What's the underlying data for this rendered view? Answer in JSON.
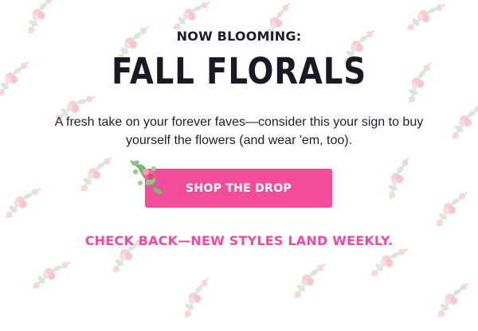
{
  "hero": {
    "eyebrow": "NOW BLOOMING:",
    "title": "FALL FLORALS",
    "body": "A fresh take on your forever faves—consider this your sign to buy yourself the flowers (and wear 'em, too).",
    "cta_label": "SHOP THE DROP",
    "note": "CHECK BACK—NEW STYLES LAND WEEKLY."
  },
  "colors": {
    "accent": "#f24d9a",
    "note_text": "#ef4aa3",
    "title_text": "#1a1a24",
    "pattern_rose": "#f3c8cf",
    "pattern_leaf": "#cfe5cf"
  },
  "icons": {
    "pattern": "rose-sprig-icon",
    "cta_decoration": "flower-sprig-icon"
  }
}
